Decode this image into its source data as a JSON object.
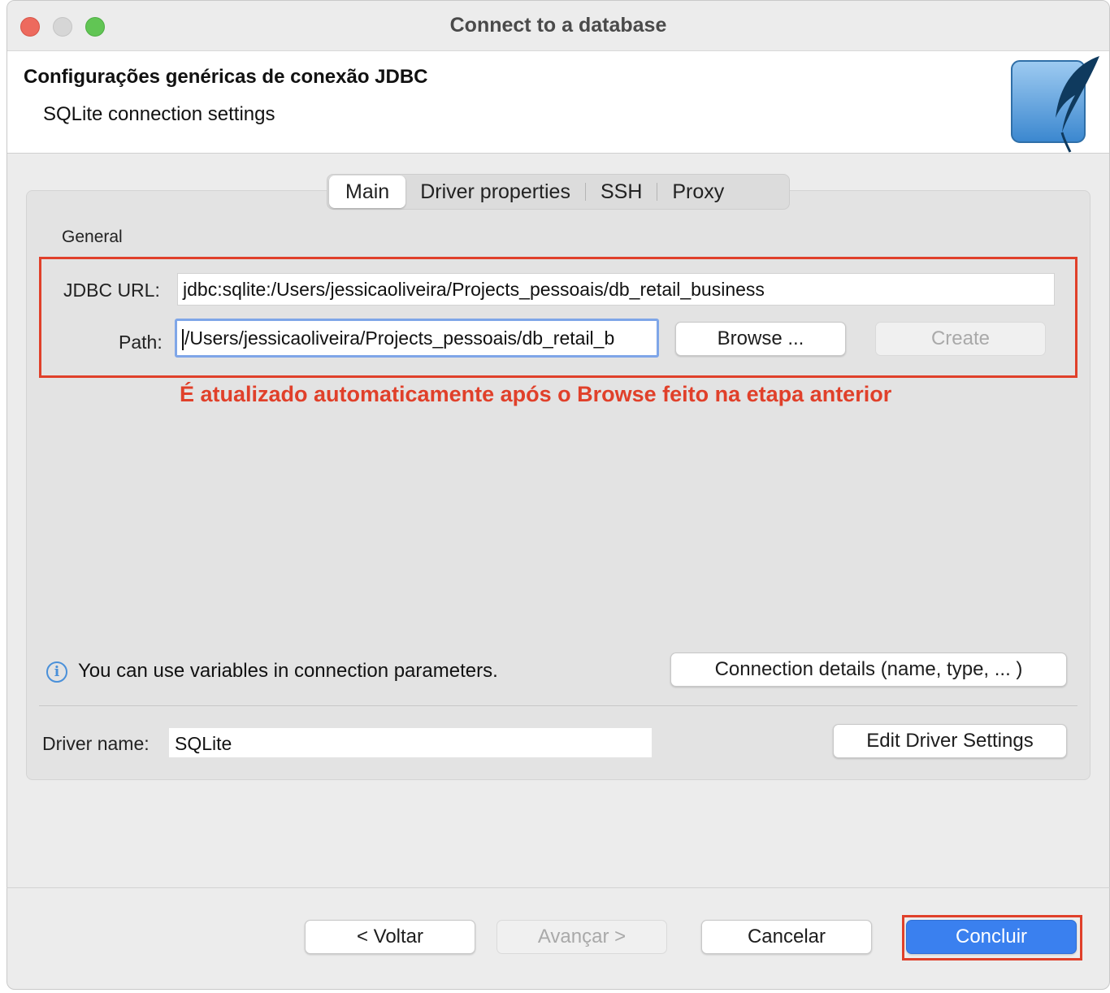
{
  "window": {
    "title": "Connect to a database"
  },
  "header": {
    "title": "Configurações genéricas de conexão JDBC",
    "subtitle": "SQLite connection settings",
    "logo_icon": "sqlite-feather-icon"
  },
  "tabs": [
    {
      "label": "Main",
      "active": true
    },
    {
      "label": "Driver properties",
      "active": false
    },
    {
      "label": "SSH",
      "active": false
    },
    {
      "label": "Proxy",
      "active": false
    }
  ],
  "general": {
    "section_label": "General",
    "jdbc_url_label": "JDBC URL:",
    "jdbc_url_value": "jdbc:sqlite:/Users/jessicaoliveira/Projects_pessoais/db_retail_business",
    "path_label": "Path:",
    "path_value": "/Users/jessicaoliveira/Projects_pessoais/db_retail_b",
    "browse_label": "Browse ...",
    "create_label": "Create"
  },
  "annotation": "É atualizado automaticamente após o Browse feito na etapa anterior",
  "info": {
    "icon": "info-icon",
    "text": "You can use variables in connection parameters.",
    "connection_details_label": "Connection details (name, type, ... )"
  },
  "driver": {
    "label": "Driver name:",
    "value": "SQLite",
    "edit_label": "Edit Driver Settings"
  },
  "footer": {
    "back_label": "< Voltar",
    "next_label": "Avançar >",
    "cancel_label": "Cancelar",
    "finish_label": "Concluir"
  },
  "colors": {
    "annotation_red": "#e0402a",
    "primary_blue": "#3a80ef",
    "focus_ring": "#7fa6e8"
  }
}
